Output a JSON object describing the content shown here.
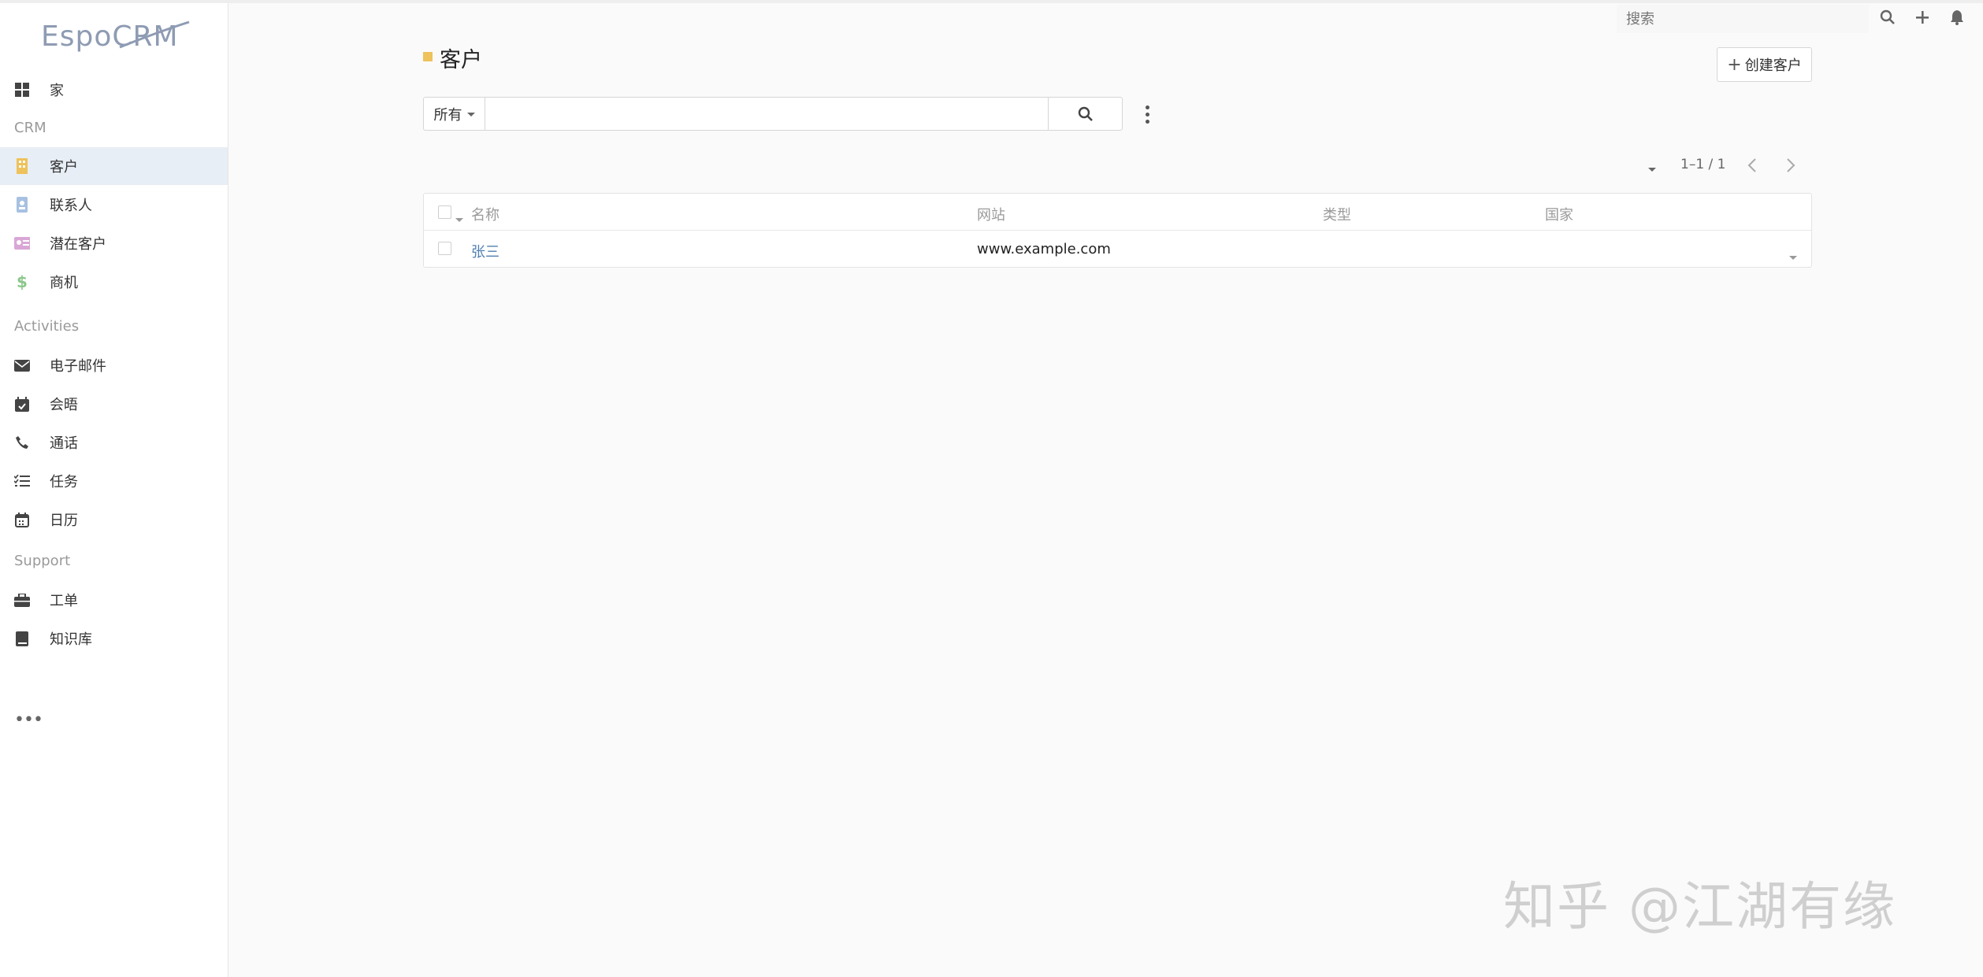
{
  "app": {
    "logo_text": "EspoCRM"
  },
  "sidebar": {
    "home": {
      "label": "家",
      "icon": "dashboard-icon"
    },
    "sections": [
      {
        "label": "CRM"
      },
      {
        "label": "Activities"
      },
      {
        "label": "Support"
      }
    ],
    "items": [
      {
        "label": "客户",
        "icon": "building-icon",
        "color": "#eec25c",
        "active": true
      },
      {
        "label": "联系人",
        "icon": "contact-card-icon",
        "color": "#a7c1e0"
      },
      {
        "label": "潜在客户",
        "icon": "id-card-icon",
        "color": "#d9a7d6"
      },
      {
        "label": "商机",
        "icon": "dollar-icon",
        "color": "#8cc68b"
      },
      {
        "label": "电子邮件",
        "icon": "envelope-icon"
      },
      {
        "label": "会晤",
        "icon": "calendar-check-icon"
      },
      {
        "label": "通话",
        "icon": "phone-icon"
      },
      {
        "label": "任务",
        "icon": "task-list-icon"
      },
      {
        "label": "日历",
        "icon": "calendar-icon"
      },
      {
        "label": "工单",
        "icon": "briefcase-icon"
      },
      {
        "label": "知识库",
        "icon": "book-icon"
      }
    ],
    "more_icon": "ellipsis-icon"
  },
  "topbar": {
    "search_placeholder": "搜索",
    "icons": [
      "search-icon",
      "plus-icon",
      "bell-icon"
    ]
  },
  "header": {
    "title": "客户",
    "title_marker_color": "#eec25c",
    "create_label": "创建客户"
  },
  "search": {
    "filter_label": "所有",
    "value": ""
  },
  "pagination": {
    "text": "1–1 / 1"
  },
  "table": {
    "columns": [
      "名称",
      "网站",
      "类型",
      "国家"
    ],
    "rows": [
      {
        "name": "张三",
        "website": "www.example.com",
        "type": "",
        "country": ""
      }
    ]
  },
  "watermark": "知乎 @江湖有缘"
}
